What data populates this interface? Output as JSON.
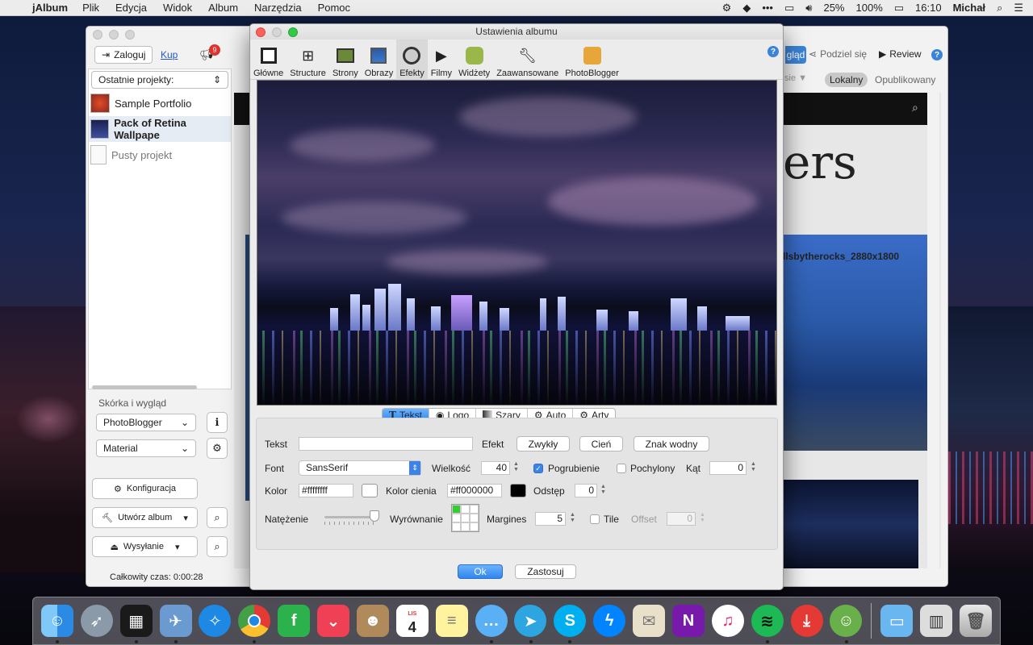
{
  "menubar": {
    "app": "jAlbum",
    "menus": [
      "Plik",
      "Edycja",
      "Widok",
      "Album",
      "Narzędzia",
      "Pomoc"
    ],
    "battery": "25%",
    "volume": "100%",
    "time": "16:10",
    "user": "Michał",
    "more": "•••"
  },
  "main": {
    "login": "Zaloguj",
    "buy": "Kup",
    "notifications": "9",
    "share_view": "gląd",
    "share": "Podziel się",
    "review": "Review",
    "local": "Lokalny",
    "published": "Opublikowany",
    "recent_projects": "Ostatnie projekty:",
    "projects": [
      {
        "name": "Sample Portfolio"
      },
      {
        "name": "Pack of Retina Wallpape"
      },
      {
        "name": "Pusty projekt"
      }
    ],
    "skin_group": "Skórka i wygląd",
    "skin": "PhotoBlogger",
    "style": "Material",
    "config": "Konfiguracja",
    "make_album": "Utwórz album",
    "upload": "Wysyłanie",
    "total_time": "Całkowity czas: 0:00:28",
    "preview_heading": "ers",
    "preview_caption": "llsbytherocks_2880x1800",
    "preview_filter_partial": "sie ▼"
  },
  "dialog": {
    "title": "Ustawienia albumu",
    "tools": [
      {
        "label": "Główne",
        "icon": "monitor-icon"
      },
      {
        "label": "Structure",
        "icon": "tree-icon"
      },
      {
        "label": "Strony",
        "icon": "pages-icon"
      },
      {
        "label": "Obrazy",
        "icon": "image-icon"
      },
      {
        "label": "Efekty",
        "icon": "lens-icon"
      },
      {
        "label": "Filmy",
        "icon": "film-icon"
      },
      {
        "label": "Widżety",
        "icon": "widget-icon"
      },
      {
        "label": "Zaawansowane",
        "icon": "wrench-icon"
      },
      {
        "label": "PhotoBlogger",
        "icon": "skin-icon"
      }
    ],
    "help": "?",
    "tabs": [
      {
        "label": "Tekst",
        "icon": "text-icon"
      },
      {
        "label": "Logo",
        "icon": "logo-icon"
      },
      {
        "label": "Szary",
        "icon": "gray-icon"
      },
      {
        "label": "Auto",
        "icon": "gear-icon"
      },
      {
        "label": "Arty",
        "icon": "gear-icon"
      }
    ],
    "form": {
      "text_label": "Tekst",
      "text_value": "",
      "effect_label": "Efekt",
      "effects": [
        "Zwykły",
        "Cień",
        "Znak wodny"
      ],
      "font_label": "Font",
      "font_value": "SansSerif",
      "size_label": "Wielkość",
      "size_value": "40",
      "bold_label": "Pogrubienie",
      "bold_checked": true,
      "italic_label": "Pochylony",
      "angle_label": "Kąt",
      "angle_value": "0",
      "color_label": "Kolor",
      "color_value": "#ffffffff",
      "shadow_color_label": "Kolor cienia",
      "shadow_color_value": "#ff000000",
      "spacing_label": "Odstęp",
      "spacing_value": "0",
      "intensity_label": "Natężenie",
      "intensity_level": 1.0,
      "align_label": "Wyrównanie",
      "margins_label": "Margines",
      "margins_value": "5",
      "tile_label": "Tile",
      "offset_label": "Offset",
      "offset_value": "0"
    },
    "ok": "Ok",
    "apply": "Zastosuj"
  },
  "dock": [
    "Finder",
    "Launchpad",
    "Photo Slideshow",
    "Preview",
    "Safari",
    "Chrome",
    "Feedly",
    "Pocket",
    "Contacts",
    "Calendar",
    "Notes",
    "Messages",
    "Telegram",
    "Skype",
    "Messenger",
    "Photos",
    "OneNote",
    "iTunes",
    "Spotify",
    "Downloader",
    "jAlbum",
    "Applications",
    "Downloads",
    "Trash"
  ],
  "calendar_day": "4",
  "calendar_month": "LIS"
}
